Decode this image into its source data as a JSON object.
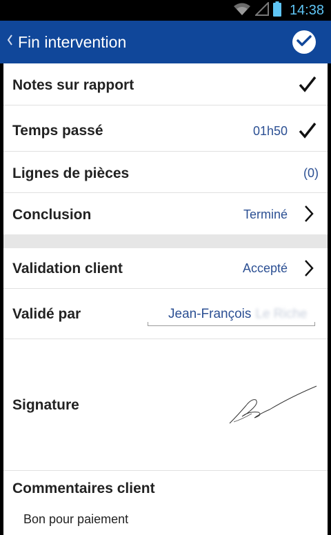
{
  "status_bar": {
    "time": "14:38",
    "icons": [
      "wifi-icon",
      "signal-icon",
      "battery-icon"
    ]
  },
  "action_bar": {
    "title": "Fin intervention",
    "back_icon": "chevron-left-icon",
    "confirm_icon": "check-circle-icon",
    "background": "#10479a"
  },
  "rows": {
    "notes": {
      "label": "Notes sur rapport"
    },
    "temps": {
      "label": "Temps passé",
      "value": "01h50"
    },
    "lignes": {
      "label": "Lignes de pièces",
      "value": "(0)"
    },
    "conclusion": {
      "label": "Conclusion",
      "value": "Terminé"
    },
    "validation": {
      "label": "Validation client",
      "value": "Accepté"
    },
    "valide_par": {
      "label": "Validé par",
      "value": "Jean-François",
      "value_blurred": "Le Riche"
    },
    "signature": {
      "label": "Signature"
    },
    "commentaires": {
      "label": "Commentaires client",
      "value": "Bon pour paiement"
    }
  },
  "colors": {
    "accent_text": "#2b4f93",
    "separator": "#e6e6e6"
  }
}
